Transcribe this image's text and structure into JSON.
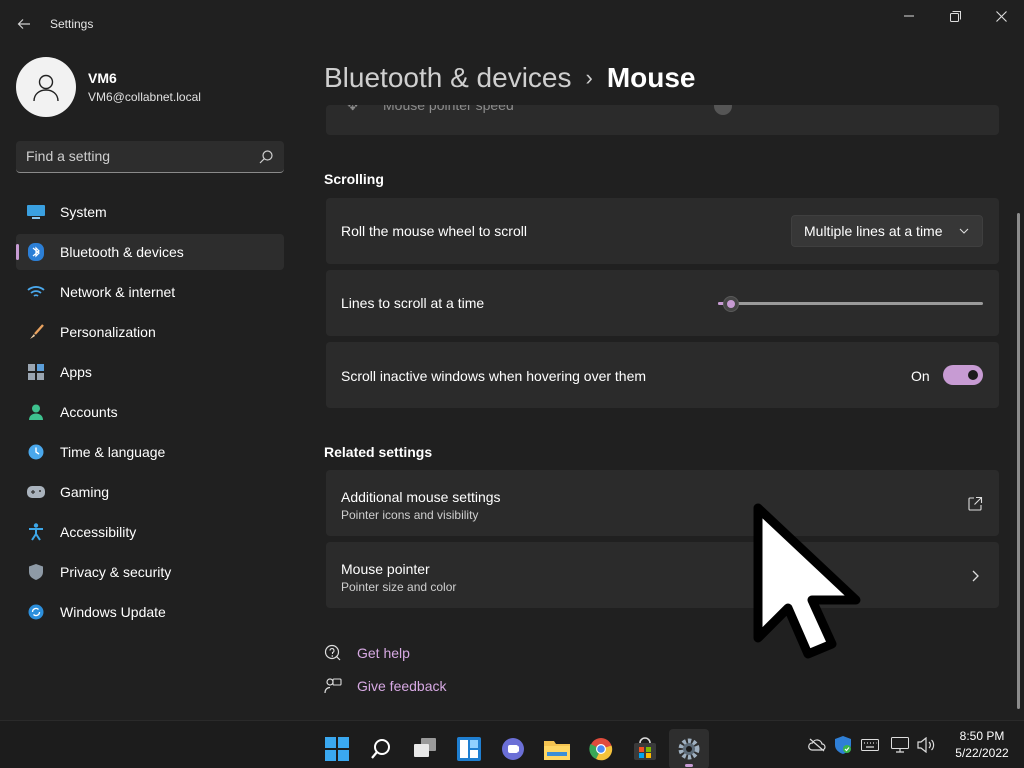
{
  "window": {
    "title": "Settings",
    "controls": {
      "minimize": "minimize-icon",
      "maximize": "restore-icon",
      "close": "close-icon"
    }
  },
  "profile": {
    "name": "VM6",
    "email": "VM6@collabnet.local"
  },
  "search": {
    "placeholder": "Find a setting"
  },
  "sidebar": {
    "items": [
      {
        "label": "System",
        "icon": "system-icon",
        "active": false
      },
      {
        "label": "Bluetooth & devices",
        "icon": "bluetooth-icon",
        "active": true
      },
      {
        "label": "Network & internet",
        "icon": "wifi-icon",
        "active": false
      },
      {
        "label": "Personalization",
        "icon": "brush-icon",
        "active": false
      },
      {
        "label": "Apps",
        "icon": "apps-icon",
        "active": false
      },
      {
        "label": "Accounts",
        "icon": "person-icon",
        "active": false
      },
      {
        "label": "Time & language",
        "icon": "clock-globe-icon",
        "active": false
      },
      {
        "label": "Gaming",
        "icon": "gamepad-icon",
        "active": false
      },
      {
        "label": "Accessibility",
        "icon": "accessibility-icon",
        "active": false
      },
      {
        "label": "Privacy & security",
        "icon": "shield-icon",
        "active": false
      },
      {
        "label": "Windows Update",
        "icon": "update-icon",
        "active": false
      }
    ]
  },
  "header": {
    "parent": "Bluetooth & devices",
    "separator": "›",
    "current": "Mouse"
  },
  "main": {
    "partial_row": {
      "label": "Mouse pointer speed"
    },
    "scrolling": {
      "title": "Scrolling",
      "wheel": {
        "label": "Roll the mouse wheel to scroll",
        "value": "Multiple lines at a time"
      },
      "lines": {
        "label": "Lines to scroll at a time",
        "level": 0.05
      },
      "inactive": {
        "label": "Scroll inactive windows when hovering over them",
        "state": "On",
        "on": true
      }
    },
    "related": {
      "title": "Related settings",
      "additional": {
        "label": "Additional mouse settings",
        "sub": "Pointer icons and visibility"
      },
      "pointer": {
        "label": "Mouse pointer",
        "sub": "Pointer size and color"
      }
    },
    "links": {
      "help": "Get help",
      "feedback": "Give feedback"
    }
  },
  "taskbar": {
    "apps": [
      "start-icon",
      "search-icon",
      "task-view-icon",
      "widgets-icon",
      "teams-chat-icon",
      "file-explorer-icon",
      "chrome-icon",
      "store-icon",
      "settings-icon"
    ],
    "clock": {
      "time": "8:50 PM",
      "date": "5/22/2022"
    }
  },
  "colors": {
    "accent": "#c79bd3",
    "background": "#202020",
    "card": "#2b2b2b",
    "link": "#d7a9e3"
  }
}
